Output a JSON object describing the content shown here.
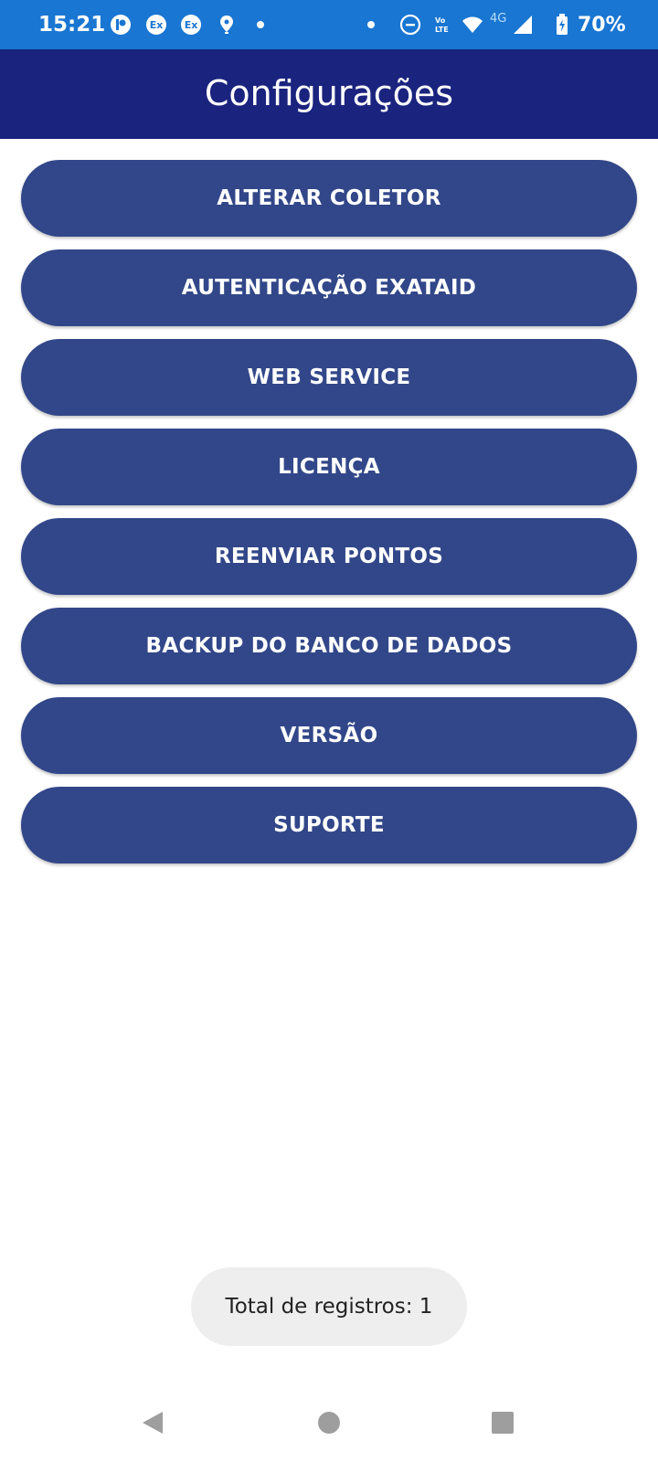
{
  "status_bar": {
    "time": "15:21",
    "battery": "70%",
    "network": "4G",
    "icons": [
      "app-p-icon",
      "exatas-icon",
      "exatas-icon",
      "location-icon",
      "dot-icon",
      "dot-icon",
      "do-not-disturb-icon",
      "volte-icon",
      "wifi-icon",
      "signal-icon",
      "battery-icon"
    ],
    "background": "#1976d2"
  },
  "app_bar": {
    "title": "Configurações",
    "background": "#1a237e"
  },
  "menu": {
    "button_color": "#324789",
    "items": [
      {
        "label": "ALTERAR COLETOR"
      },
      {
        "label": "AUTENTICAÇÃO EXATAID"
      },
      {
        "label": "WEB SERVICE"
      },
      {
        "label": "LICENÇA"
      },
      {
        "label": "REENVIAR PONTOS"
      },
      {
        "label": "BACKUP DO BANCO DE DADOS"
      },
      {
        "label": "VERSÃO"
      },
      {
        "label": "SUPORTE"
      }
    ]
  },
  "toast": {
    "text": "Total de registros: 1"
  },
  "nav_bar": {
    "icons": [
      "back-icon",
      "home-icon",
      "recents-icon"
    ]
  }
}
